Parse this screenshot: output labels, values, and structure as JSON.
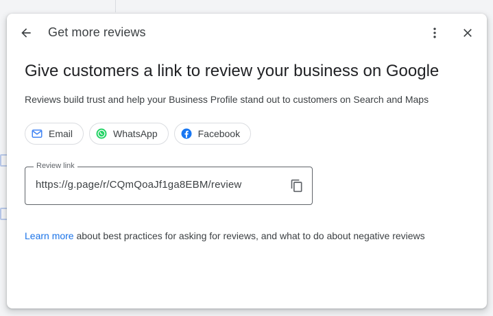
{
  "dialog": {
    "title": "Get more reviews",
    "headline": "Give customers a link to review your business on Google",
    "subtext": "Reviews build trust and help your Business Profile stand out to customers on Search and Maps",
    "share_options": [
      {
        "label": "Email",
        "icon": "mail-icon"
      },
      {
        "label": "WhatsApp",
        "icon": "whatsapp-icon"
      },
      {
        "label": "Facebook",
        "icon": "facebook-icon"
      }
    ],
    "review_link": {
      "label": "Review link",
      "value": "https://g.page/r/CQmQoaJf1ga8EBM/review"
    },
    "learn_more": {
      "link_text": "Learn more",
      "rest_text": " about best practices for asking for reviews, and what to do about negative reviews"
    }
  },
  "colors": {
    "link": "#1a73e8",
    "whatsapp": "#25d366",
    "facebook": "#1877f2",
    "mail": "#4285f4"
  }
}
